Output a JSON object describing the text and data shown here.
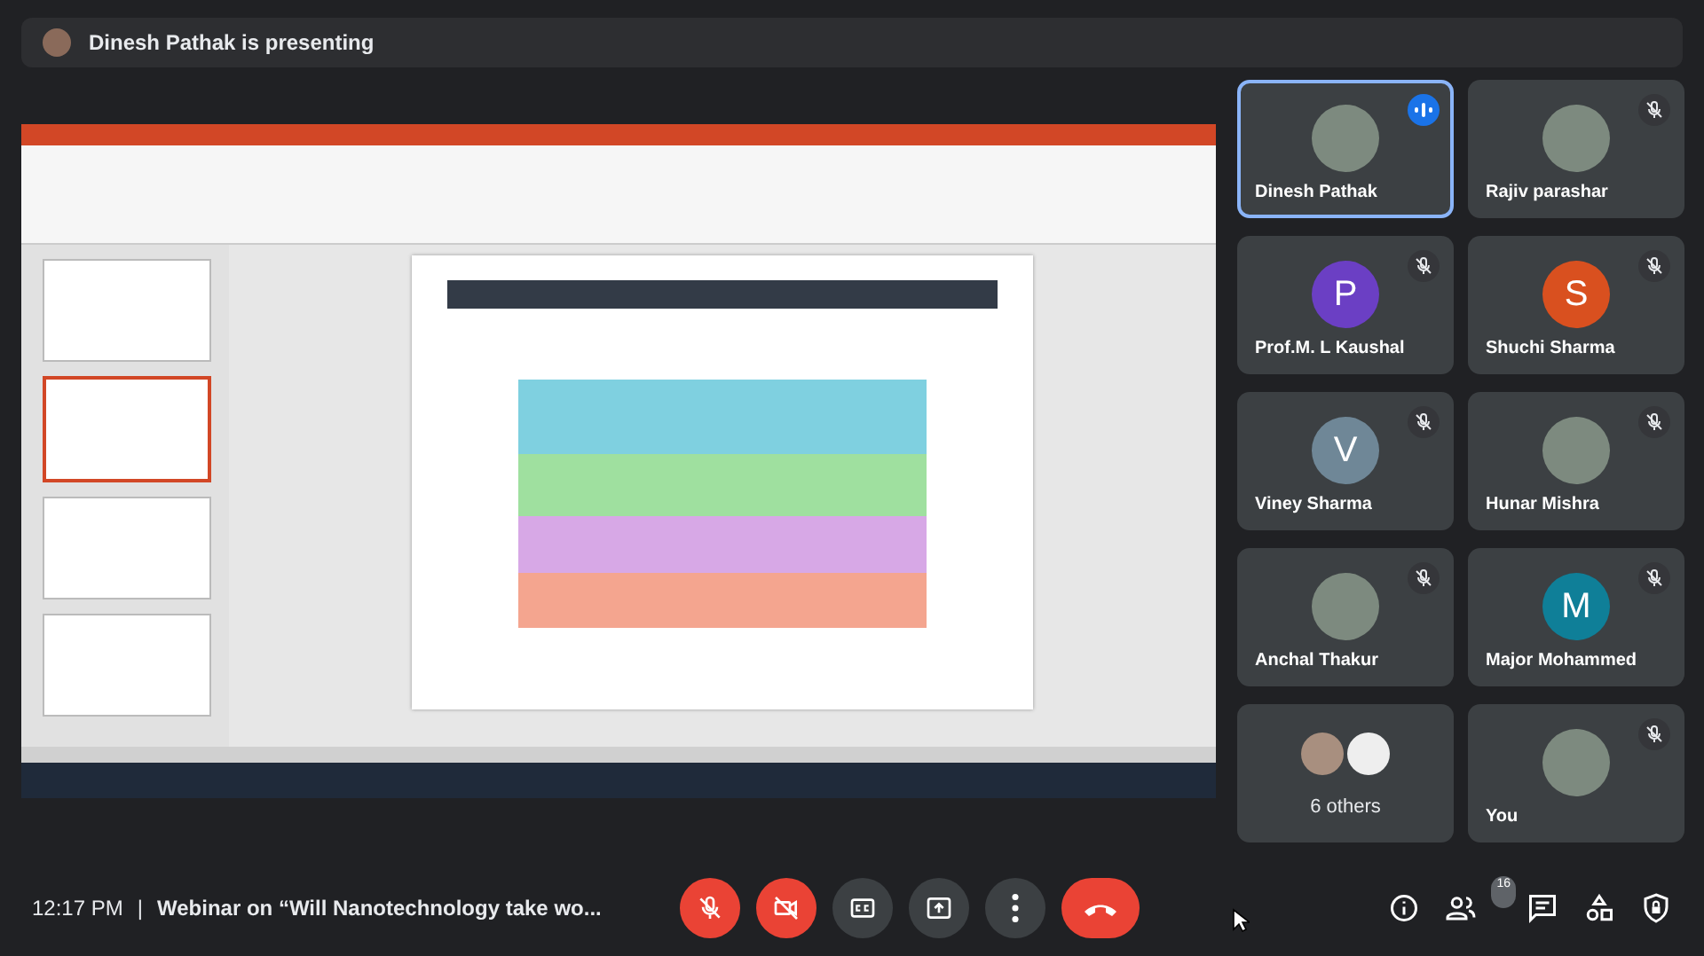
{
  "banner": {
    "text": "Dinesh Pathak is presenting"
  },
  "participants": [
    {
      "kind": "photo",
      "name": "Dinesh Pathak",
      "muted": false,
      "speaking": true,
      "selected": true
    },
    {
      "kind": "photo",
      "name": "Rajiv parashar",
      "muted": true,
      "speaking": false,
      "selected": false
    },
    {
      "kind": "letter",
      "name": "Prof.M. L Kaushal",
      "letter": "P",
      "color": "#6b3fc4",
      "muted": true,
      "speaking": false,
      "selected": false
    },
    {
      "kind": "letter",
      "name": "Shuchi Sharma",
      "letter": "S",
      "color": "#d9501f",
      "muted": true,
      "speaking": false,
      "selected": false
    },
    {
      "kind": "letter",
      "name": "Viney Sharma",
      "letter": "V",
      "color": "#6f8797",
      "muted": true,
      "speaking": false,
      "selected": false
    },
    {
      "kind": "photo",
      "name": "Hunar Mishra",
      "muted": true,
      "speaking": false,
      "selected": false
    },
    {
      "kind": "photo",
      "name": "Anchal Thakur",
      "muted": true,
      "speaking": false,
      "selected": false
    },
    {
      "kind": "letter",
      "name": "Major Mohammed",
      "letter": "M",
      "color": "#0f7f98",
      "muted": true,
      "speaking": false,
      "selected": false
    },
    {
      "kind": "others",
      "name": "6 others",
      "muted": false,
      "speaking": false,
      "selected": false
    },
    {
      "kind": "photo",
      "name": "You",
      "muted": true,
      "speaking": false,
      "selected": false
    }
  ],
  "bottom_bar": {
    "time": "12:17 PM",
    "separator": "|",
    "meeting_title": "Webinar on “Will Nanotechnology take wo...",
    "controls": [
      {
        "kind": "mic",
        "on": false
      },
      {
        "kind": "camera",
        "on": false
      },
      {
        "kind": "captions"
      },
      {
        "kind": "present"
      },
      {
        "kind": "more"
      },
      {
        "kind": "end"
      }
    ],
    "participant_count": "16"
  }
}
